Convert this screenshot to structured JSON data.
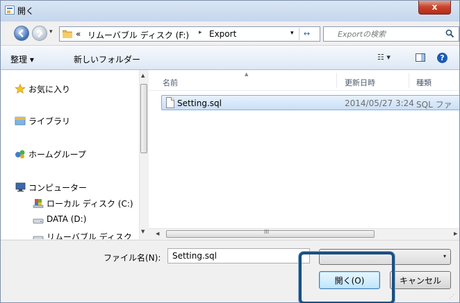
{
  "window": {
    "title": "開く",
    "close_glyph": "x"
  },
  "address_bar": {
    "overflow": "«",
    "segments": [
      "リムーバブル ディスク (F:)",
      "Export"
    ],
    "separator": "▸",
    "dropdown_glyph": "▾",
    "refresh_glyph": "↔"
  },
  "search": {
    "placeholder": "Exportの検索"
  },
  "toolbar": {
    "organize_label": "整理 ▾",
    "new_folder_label": "新しいフォルダー",
    "view_glyph": "☷ ▾",
    "help_glyph": "?"
  },
  "nav_pane": {
    "items": [
      {
        "label": "お気に入り",
        "icon": "star-icon"
      },
      {
        "label": "ライブラリ",
        "icon": "library-icon"
      },
      {
        "label": "ホームグループ",
        "icon": "homegroup-icon"
      },
      {
        "label": "コンピューター",
        "icon": "computer-icon"
      },
      {
        "label": "ローカル ディスク (C:)",
        "icon": "drive-c-icon"
      },
      {
        "label": "DATA (D:)",
        "icon": "drive-icon"
      },
      {
        "label": "リムーバブル ディスク",
        "icon": "removable-drive-icon"
      }
    ]
  },
  "file_list": {
    "columns": [
      "名前",
      "更新日時",
      "種類"
    ],
    "sort_glyph": "▲",
    "rows": [
      {
        "name": "Setting.sql",
        "modified": "2014/05/27 3:24",
        "type": "SQL ファ"
      }
    ]
  },
  "scrollbars": {
    "up": "▲",
    "down": "▼",
    "left": "◀",
    "right": "▶",
    "grip": "III"
  },
  "footer": {
    "filename_label": "ファイル名(N):",
    "filename_value": "Setting.sql",
    "filetype_arrow": "▾",
    "open_label": "開く(O)",
    "cancel_label": "キャンセル",
    "resize_grip": "⋰"
  },
  "colors": {
    "highlight_frame": "#1b4f80",
    "selection": "#c9dff7",
    "close_button": "#c9462f"
  }
}
